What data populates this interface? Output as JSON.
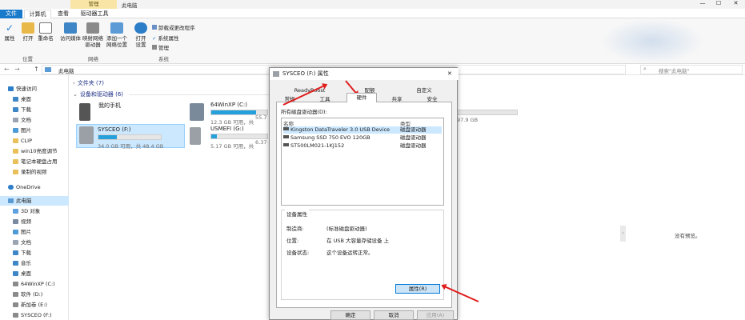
{
  "window": {
    "manage_label": "管理",
    "title": "此电脑"
  },
  "tabs": {
    "file": "文件",
    "computer": "计算机",
    "view": "查看",
    "drive_tools": "驱动器工具"
  },
  "ribbon": {
    "buttons": [
      {
        "label": "属性",
        "icon": "check-icon"
      },
      {
        "label": "打开",
        "icon": "folder-open-icon"
      },
      {
        "label": "重命名",
        "icon": "rename-icon"
      },
      {
        "label": "访问媒体",
        "icon": "media-icon"
      },
      {
        "label": "映射网络\n驱动器",
        "icon": "map-drive-icon"
      },
      {
        "label": "添加一个\n网络位置",
        "icon": "network-location-icon"
      },
      {
        "label": "打开\n设置",
        "icon": "settings-icon"
      }
    ],
    "small": [
      "卸载或更改程序",
      "系统属性",
      "管理"
    ],
    "groups": {
      "location": "位置",
      "network": "网络",
      "system": "系统"
    }
  },
  "address": {
    "path": "此电脑",
    "search_placeholder": "搜索\"此电脑\""
  },
  "nav": {
    "quick_access": "快速访问",
    "pinned": [
      "桌面",
      "下载",
      "文档",
      "图片"
    ],
    "folders": [
      "CLIP",
      "win10亮度调节",
      "笔记本硬盘占用",
      "录制的视频"
    ],
    "onedrive": "OneDrive",
    "this_pc": "此电脑",
    "pc_items": [
      "3D 对象",
      "视频",
      "图片",
      "文档",
      "下载",
      "音乐",
      "桌面",
      "64WinXP (C:)",
      "软件 (D:)",
      "新加卷 (E:)",
      "SYSCEO (F:)"
    ]
  },
  "main": {
    "folders_header": "文件夹 (7)",
    "devices_header": "设备和驱动器 (6)",
    "drives": [
      {
        "name": "我的手机",
        "size": "",
        "fill": 0
      },
      {
        "name": "SYSCEO (F:)",
        "size": "34.0 GB 可用，共 48.4 GB",
        "fill": 0.3
      },
      {
        "name": "64WinXP (C:)",
        "size": "12.3 GB 可用，共",
        "fill": 0.8
      },
      {
        "name": "USMEFI (G:)",
        "size": "5.17 GB 可用，共",
        "fill": 0.1
      }
    ],
    "partial": [
      "55.7 GB",
      "6.37 GB",
      "97.9 GB"
    ]
  },
  "preview": {
    "text": "没有预览。"
  },
  "dialog": {
    "title": "SYSCEO (F:) 属性",
    "tabs_row1": [
      "ReadyBoost",
      "配额",
      "自定义"
    ],
    "tabs_row2": [
      "常规",
      "工具",
      "硬件",
      "共享",
      "安全"
    ],
    "list_label": "所有磁盘驱动器(D):",
    "col_name": "名称",
    "col_type": "类型",
    "rows": [
      {
        "name": "Kingston DataTraveler 3.0 USB Device",
        "type": "磁盘驱动器"
      },
      {
        "name": "Samsung SSD 750 EVO 120GB",
        "type": "磁盘驱动器"
      },
      {
        "name": "ST500LM021-1KJ152",
        "type": "磁盘驱动器"
      }
    ],
    "props_label": "设备属性",
    "maker_label": "制造商:",
    "maker_value": "(标准磁盘驱动器)",
    "location_label": "位置:",
    "location_value": "在 USB 大容量存储设备 上",
    "status_label": "设备状态:",
    "status_value": "这个设备运转正常。",
    "props_button": "属性(R)",
    "ok": "确定",
    "cancel": "取消",
    "apply": "应用(A)"
  }
}
